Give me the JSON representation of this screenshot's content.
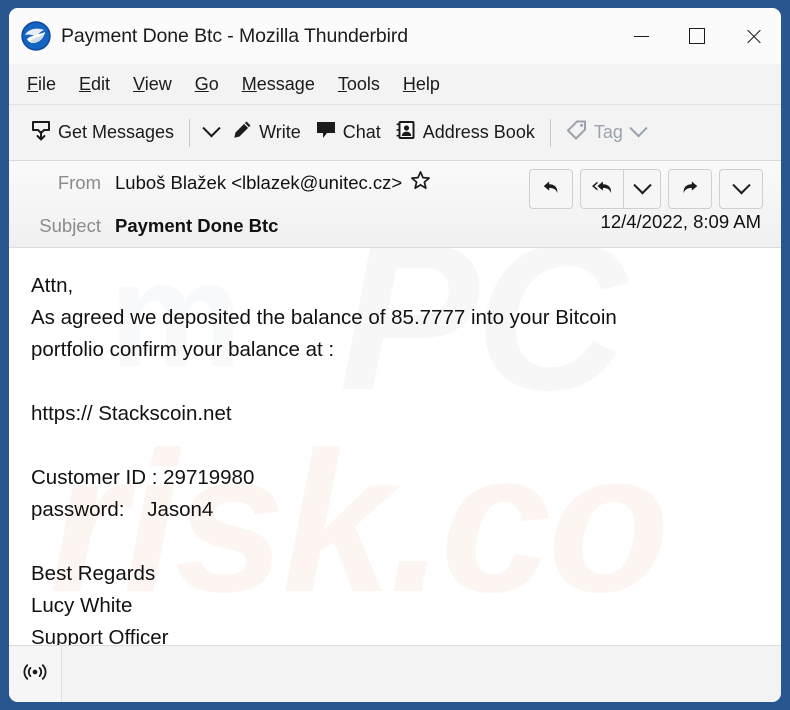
{
  "window": {
    "title": "Payment Done Btc - Mozilla Thunderbird",
    "logo_icon": "thunderbird-logo-icon",
    "controls": {
      "minimize": "minimize-icon",
      "maximize": "maximize-icon",
      "close": "close-icon"
    }
  },
  "menubar": {
    "items": [
      {
        "accesskey": "F",
        "rest": "ile"
      },
      {
        "accesskey": "E",
        "rest": "dit"
      },
      {
        "accesskey": "V",
        "rest": "iew"
      },
      {
        "accesskey": "G",
        "rest": "o"
      },
      {
        "accesskey": "M",
        "rest": "essage"
      },
      {
        "accesskey": "T",
        "rest": "ools"
      },
      {
        "accesskey": "H",
        "rest": "elp"
      }
    ]
  },
  "toolbar": {
    "get_messages": "Get Messages",
    "get_messages_icon": "inbox-download-icon",
    "write": "Write",
    "write_icon": "pencil-icon",
    "chat": "Chat",
    "chat_icon": "speech-bubble-icon",
    "address_book": "Address Book",
    "address_book_icon": "contact-card-icon",
    "tag": "Tag",
    "tag_icon": "tag-icon"
  },
  "message": {
    "from_label": "From",
    "from_value": "Luboš Blažek <lblazek@unitec.cz>",
    "star_icon": "star-outline-icon",
    "subject_label": "Subject",
    "subject_value": "Payment Done Btc",
    "date": "12/4/2022, 8:09 AM",
    "actions": {
      "reply_icon": "reply-icon",
      "reply_all_icon": "reply-all-icon",
      "reply_all_more_icon": "chevron-down-icon",
      "forward_icon": "forward-icon",
      "more_icon": "chevron-down-icon"
    },
    "body": "Attn,\nAs agreed we deposited the balance of 85.7777 into your Bitcoin\nportfolio confirm your balance at :\n\nhttps:// Stackscoin.net\n\nCustomer ID : 29719980\npassword:    Jason4\n\nBest Regards\nLucy White\nSupport Officer",
    "watermark_primary": "PC",
    "watermark_secondary": "risk.co",
    "watermark_tertiary": "m"
  },
  "statusbar": {
    "online_icon": "broadcast-online-icon"
  },
  "colors": {
    "window_border": "#28568F",
    "chrome_background": "#f3f3f3",
    "body_background": "#ffffff",
    "text": "#111111",
    "label_muted": "#8b8b8b",
    "disabled": "#9aa3ad"
  }
}
